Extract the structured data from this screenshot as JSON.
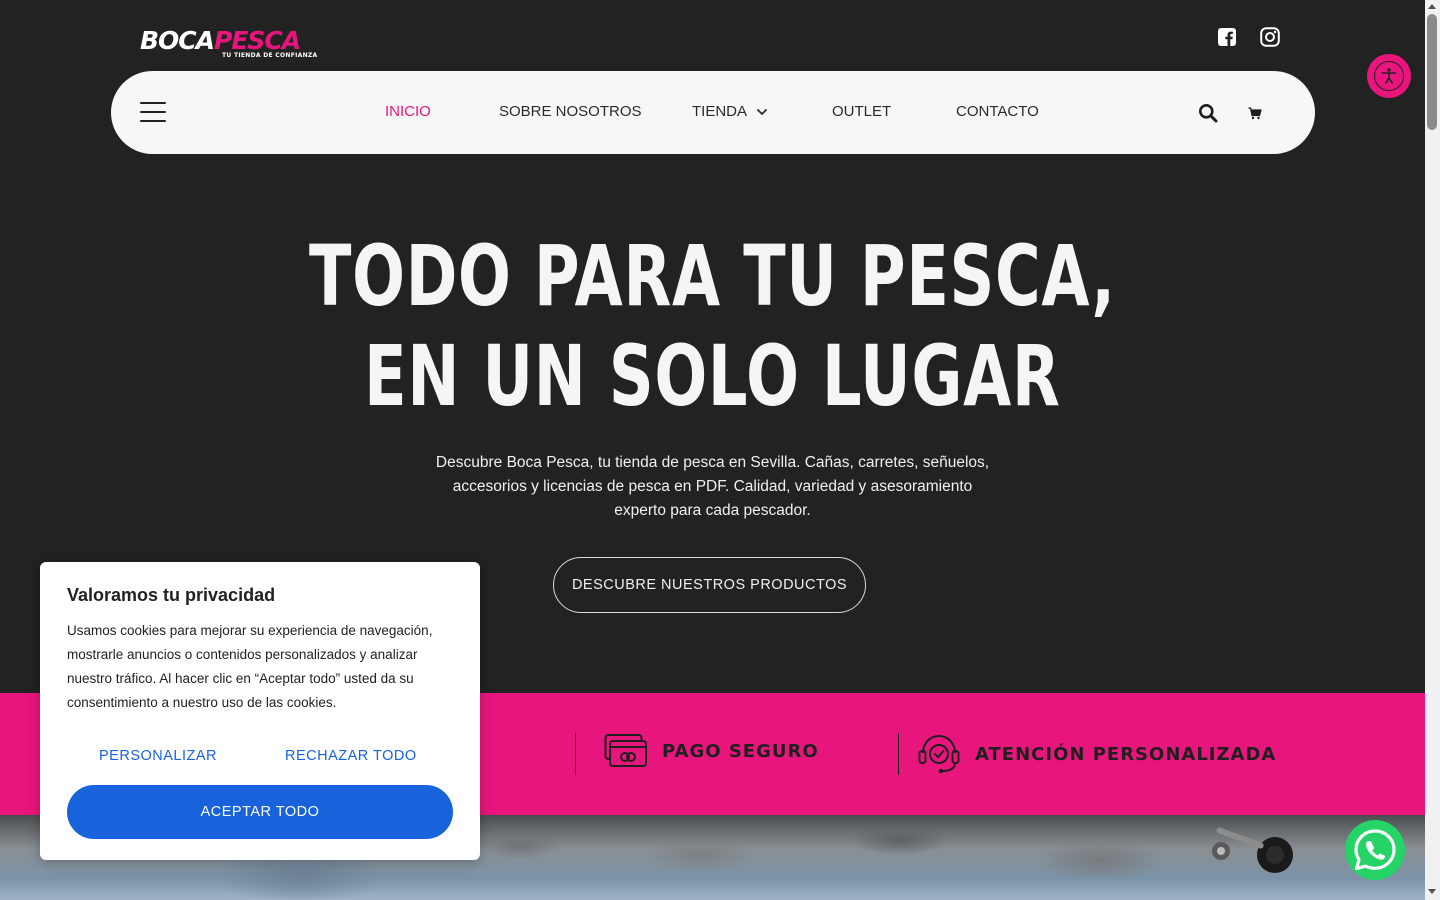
{
  "brand": {
    "name_part1": "BOCA",
    "name_part2": "PESCA",
    "tagline": "TU TIENDA DE CONFIANZA"
  },
  "colors": {
    "accent": "#e8157c",
    "background": "#222222",
    "nav_bg": "#f7f7f7",
    "cookie_button": "#1863dc",
    "whatsapp": "#25d366"
  },
  "social": {
    "facebook_icon": "facebook-icon",
    "instagram_icon": "instagram-icon"
  },
  "nav": {
    "items": [
      {
        "label": "INICIO",
        "active": true
      },
      {
        "label": "SOBRE NOSOTROS"
      },
      {
        "label": "TIENDA",
        "has_dropdown": true
      },
      {
        "label": "OUTLET"
      },
      {
        "label": "CONTACTO"
      }
    ],
    "icons": [
      "menu-icon",
      "search-icon",
      "cart-icon"
    ]
  },
  "hero": {
    "title_line1": "TODO PARA TU PESCA,",
    "title_line2": "EN UN SOLO LUGAR",
    "description": "Descubre Boca Pesca, tu tienda de pesca en Sevilla. Cañas, carretes, señuelos, accesorios y licencias de pesca en PDF. Calidad, variedad y asesoramiento experto para cada pescador.",
    "cta": "DESCUBRE NUESTROS PRODUCTOS"
  },
  "features": [
    {
      "label": "PAGO SEGURO",
      "icon": "secure-payment-icon"
    },
    {
      "label": "ATENCIÓN PERSONALIZADA",
      "icon": "customer-support-icon"
    }
  ],
  "cookie": {
    "title": "Valoramos tu privacidad",
    "text": "Usamos cookies para mejorar su experiencia de navegación, mostrarle anuncios o contenidos personalizados y analizar nuestro tráfico. Al hacer clic en “Aceptar todo” usted da su consentimiento a nuestro uso de las cookies.",
    "customize": "PERSONALIZAR",
    "reject": "RECHAZAR TODO",
    "accept": "ACEPTAR TODO"
  }
}
